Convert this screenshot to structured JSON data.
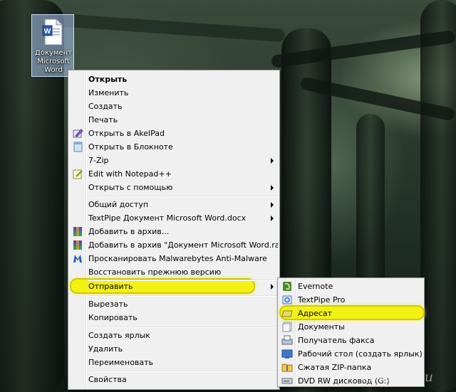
{
  "desktop": {
    "icon_label": "Документ Microsoft Word",
    "watermark": "vbereg.ru"
  },
  "context_menu": {
    "items": [
      {
        "label": "Открыть",
        "bold": true
      },
      {
        "label": "Изменить"
      },
      {
        "label": "Создать"
      },
      {
        "label": "Печать"
      },
      {
        "label": "Открыть в AkelPad",
        "icon": "akelpad-icon"
      },
      {
        "label": "Открыть в Блокноте",
        "icon": "notepad-icon"
      },
      {
        "label": "7-Zip",
        "submenu": true
      },
      {
        "label": "Edit with Notepad++",
        "icon": "notepadpp-icon"
      },
      {
        "label": "Открыть с помощью",
        "submenu": true
      },
      {
        "label": "Общий доступ",
        "submenu": true
      },
      {
        "label": "TextPipe Документ Microsoft Word.docx",
        "submenu": true
      },
      {
        "label": "Добавить в архив...",
        "icon": "winrar-icon"
      },
      {
        "label": "Добавить в архив \"Документ Microsoft Word.rar\"",
        "icon": "winrar-icon"
      },
      {
        "label": "Просканировать Malwarebytes Anti-Malware",
        "icon": "malwarebytes-icon"
      },
      {
        "label": "Восстановить прежнюю версию"
      },
      {
        "label": "Отправить",
        "submenu": true,
        "highlighted": true
      },
      {
        "label": "Вырезать"
      },
      {
        "label": "Копировать"
      },
      {
        "label": "Создать ярлык"
      },
      {
        "label": "Удалить"
      },
      {
        "label": "Переименовать"
      },
      {
        "label": "Свойства"
      }
    ]
  },
  "send_to_menu": {
    "items": [
      {
        "label": "Evernote",
        "icon": "evernote-icon"
      },
      {
        "label": "TextPipe Pro",
        "icon": "textpipe-icon"
      },
      {
        "label": "Адресат",
        "icon": "mail-recipient-icon",
        "highlighted": true
      },
      {
        "label": "Документы",
        "icon": "documents-icon"
      },
      {
        "label": "Получатель факса",
        "icon": "fax-icon"
      },
      {
        "label": "Рабочий стол (создать ярлык)",
        "icon": "desktop-icon"
      },
      {
        "label": "Сжатая ZIP-папка",
        "icon": "zip-folder-icon"
      },
      {
        "label": "DVD RW дисковод (G:)",
        "icon": "dvd-drive-icon"
      }
    ]
  },
  "colors": {
    "highlight": "#f4f200",
    "menu_bg": "#f0f0f0"
  }
}
